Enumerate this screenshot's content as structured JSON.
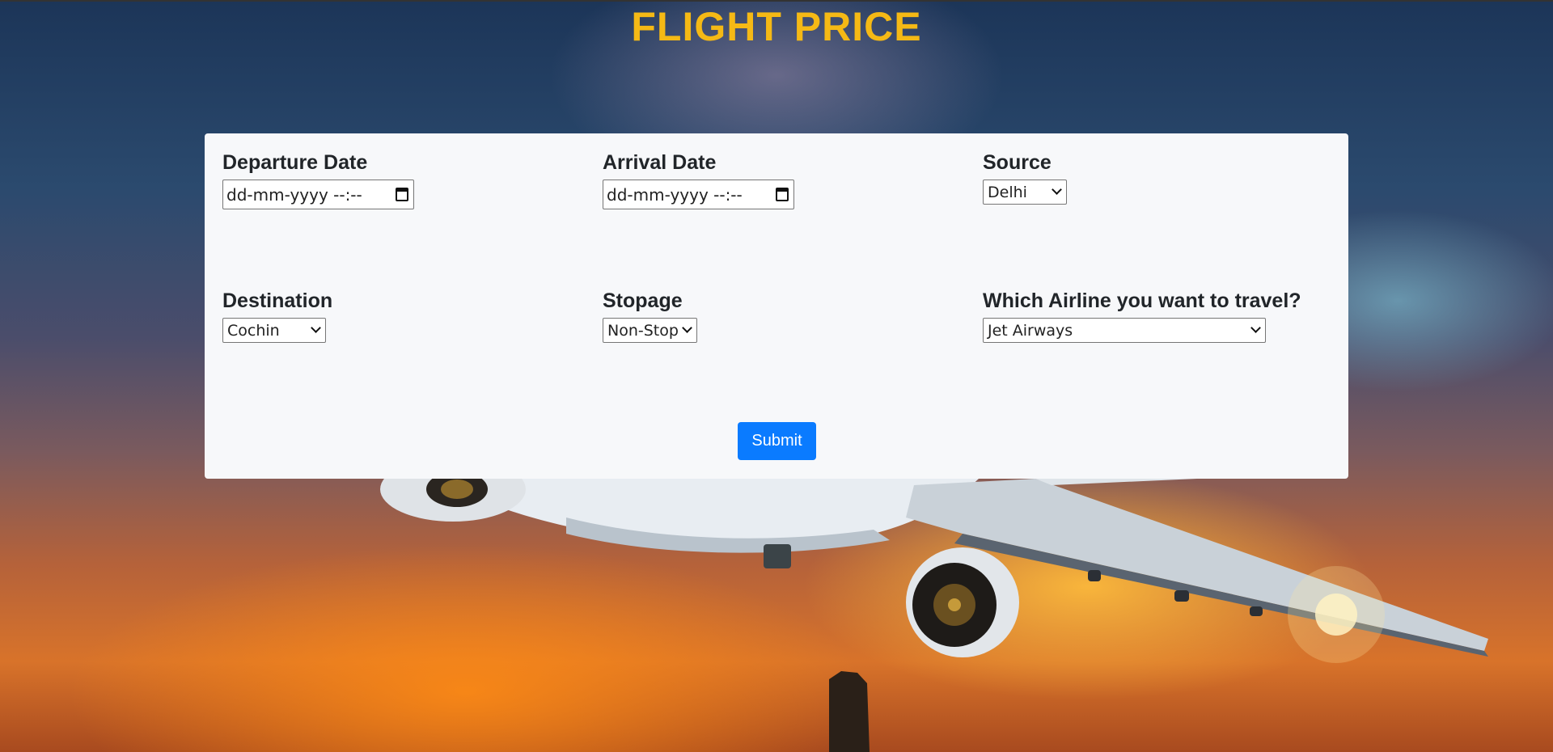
{
  "header": {
    "title": "FLIGHT PRICE"
  },
  "form": {
    "departure": {
      "label": "Departure Date",
      "placeholder": "dd-mm-yyyy --:--"
    },
    "arrival": {
      "label": "Arrival Date",
      "placeholder": "dd-mm-yyyy --:--"
    },
    "source": {
      "label": "Source",
      "selected": "Delhi"
    },
    "destination": {
      "label": "Destination",
      "selected": "Cochin"
    },
    "stopage": {
      "label": "Stopage",
      "selected": "Non-Stop"
    },
    "airline": {
      "label": "Which Airline you want to travel?",
      "selected": "Jet Airways"
    },
    "submit_label": "Submit"
  },
  "colors": {
    "title": "#f5b915",
    "submit": "#0a7bff",
    "card": "#f7f8fa"
  }
}
